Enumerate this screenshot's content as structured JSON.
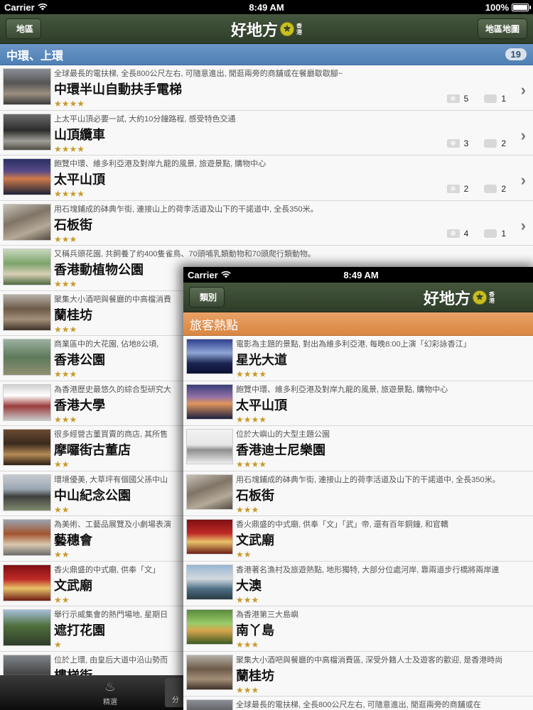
{
  "back": {
    "status": {
      "carrier": "Carrier",
      "time": "8:49 AM",
      "battery": "100%",
      "battery_level": 1.0
    },
    "nav": {
      "back_label": "地區",
      "title": "好地方",
      "logo_sub": [
        "香",
        "港"
      ],
      "right_label": "地區地圖"
    },
    "section": {
      "title": "中環、上環",
      "count": "19"
    },
    "rows": [
      {
        "desc": "全球最長的電扶梯, 全長800公尺左右, 可隨意進出, 閒逛兩旁的商舖或在餐廳歇歇腳~",
        "name": "中環半山自動扶手電梯",
        "stars": "★★★★",
        "photos": "5",
        "comments": "1"
      },
      {
        "desc": "上太平山頂必要一試, 大約10分鐘路程, 感受特色交通",
        "name": "山頂纜車",
        "stars": "★★★★",
        "photos": "3",
        "comments": "2"
      },
      {
        "desc": "飽覽中環、維多利亞港及對岸九龍的風景, 旅遊景點, 購物中心",
        "name": "太平山頂",
        "stars": "★★★★",
        "photos": "2",
        "comments": "2"
      },
      {
        "desc": "用石塊鋪成的砵典乍街, 連接山上的荷李活道及山下的干諾道中, 全長350米。",
        "name": "石板街",
        "stars": "★★★",
        "photos": "4",
        "comments": "1"
      },
      {
        "desc": "又稱兵頭花園, 共飼養了約400隻雀鳥、70頭哺乳類動物和70頭爬行類動物。",
        "name": "香港動植物公園",
        "stars": "★★★"
      },
      {
        "desc": "聚集大小酒吧與餐廳的中高檔消費",
        "name": "蘭桂坊",
        "stars": "★★★"
      },
      {
        "desc": "商業區中的大花園, 佔地8公頃,",
        "name": "香港公園",
        "stars": "★★★"
      },
      {
        "desc": "為香港歷史最悠久的綜合型研究大",
        "name": "香港大學",
        "stars": "★★★"
      },
      {
        "desc": "很多經營古董買賣的商店, 其所售",
        "name": "摩囉街古董店",
        "stars": "★★"
      },
      {
        "desc": "環境優美, 大草坪有個國父孫中山",
        "name": "中山紀念公園",
        "stars": "★★"
      },
      {
        "desc": "為美術、工藝品展覽及小劇場表演",
        "name": "藝穗會",
        "stars": "★★"
      },
      {
        "desc": "香火鼎盛的中式廟, 供奉「文」",
        "name": "文武廟",
        "stars": "★★"
      },
      {
        "desc": "舉行示威集會的熱門場地, 星期日",
        "name": "遮打花園",
        "stars": "★"
      },
      {
        "desc": "位於上環, 由皇后大道中沿山勢而",
        "name": "樓梯街",
        "stars": ""
      }
    ],
    "tabbar": {
      "tab1_label": "精選",
      "tab2_label": "分"
    }
  },
  "front": {
    "status": {
      "carrier": "Carrier",
      "time": "8:49 AM"
    },
    "nav": {
      "back_label": "類別",
      "title": "好地方",
      "logo_sub": [
        "香",
        "港"
      ]
    },
    "section": {
      "title": "旅客熱點"
    },
    "rows": [
      {
        "desc": "電影為主題的景點, 對出為維多利亞港, 每晚8:00上演「幻彩詠香江」",
        "name": "星光大道",
        "stars": "★★★★"
      },
      {
        "desc": "飽覽中環、維多利亞港及對岸九龍的風景, 旅遊景點, 購物中心",
        "name": "太平山頂",
        "stars": "★★★★"
      },
      {
        "desc": "位於大嶼山的大型主題公園",
        "name": "香港迪士尼樂園",
        "stars": "★★★★"
      },
      {
        "desc": "用石塊鋪成的砵典乍街, 連接山上的荷李活道及山下的干諾道中, 全長350米。",
        "name": "石板街",
        "stars": "★★★"
      },
      {
        "desc": "香火鼎盛的中式廟, 供奉「文」「武」帝, 還有百年銅鐘, 和官轎",
        "name": "文武廟",
        "stars": "★★"
      },
      {
        "desc": "香港著名漁村及旅遊熱點, 地形獨特, 大部分位處河岸, 靠兩道步行橋將兩岸連",
        "name": "大澳",
        "stars": "★★★"
      },
      {
        "desc": "為香港第三大島嶼",
        "name": "南丫島",
        "stars": "★★★"
      },
      {
        "desc": "聚集大小酒吧與餐廳的中高檔消費區, 深受外籍人士及遊客的歡迎, 是香港時尚",
        "name": "蘭桂坊",
        "stars": "★★★"
      },
      {
        "desc": "全球最長的電扶梯, 全長800公尺左右, 可隨意進出, 閒逛兩旁的商舖或在",
        "name": "",
        "stars": ""
      }
    ]
  }
}
